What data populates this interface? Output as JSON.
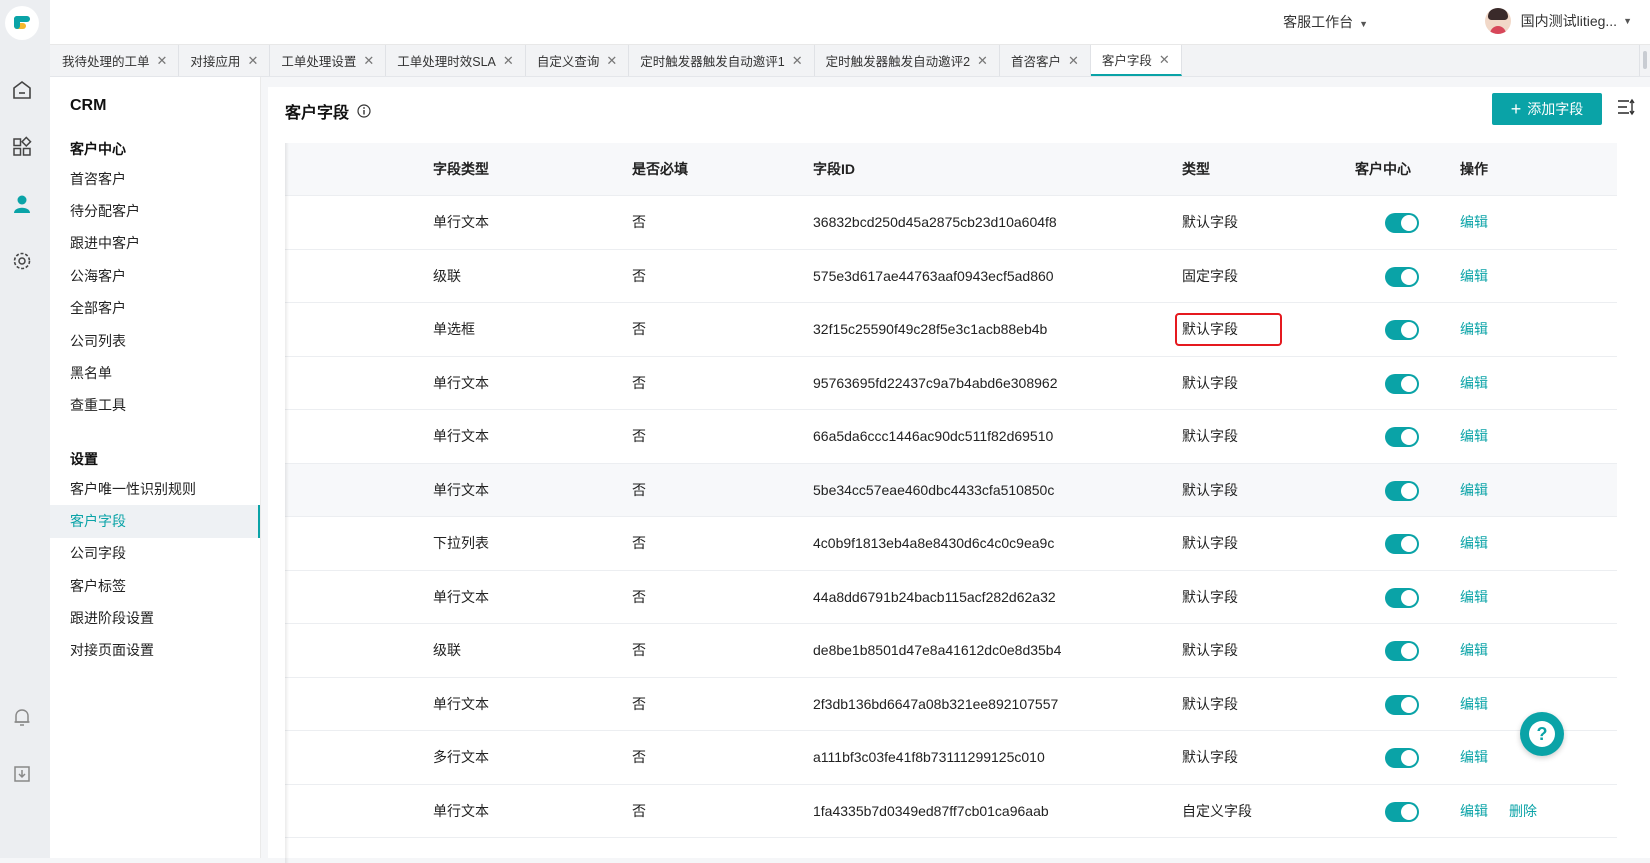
{
  "header": {
    "workspace": "客服工作台",
    "user_name": "国内测试litieg..."
  },
  "tabs": [
    {
      "label": "我待处理的工单",
      "active": false
    },
    {
      "label": "对接应用",
      "active": false
    },
    {
      "label": "工单处理设置",
      "active": false
    },
    {
      "label": "工单处理时效SLA",
      "active": false
    },
    {
      "label": "自定义查询",
      "active": false
    },
    {
      "label": "定时触发器触发自动邀评1",
      "active": false
    },
    {
      "label": "定时触发器触发自动邀评2",
      "active": false
    },
    {
      "label": "首咨客户",
      "active": false
    },
    {
      "label": "客户字段",
      "active": true
    }
  ],
  "sidebar": {
    "title": "CRM",
    "section1": "客户中心",
    "customer_items": [
      "首咨客户",
      "待分配客户",
      "跟进中客户",
      "公海客户",
      "全部客户",
      "公司列表",
      "黑名单",
      "查重工具"
    ],
    "section2": "设置",
    "settings_items": [
      "客户唯一性识别规则",
      "客户字段",
      "公司字段",
      "客户标签",
      "跟进阶段设置",
      "对接页面设置"
    ],
    "active_item": "客户字段"
  },
  "main": {
    "title": "客户字段",
    "add_button": "添加字段"
  },
  "table": {
    "columns": [
      "字段类型",
      "是否必填",
      "字段ID",
      "类型",
      "客户中心",
      "操作"
    ],
    "edit_label": "编辑",
    "delete_label": "删除",
    "rows": [
      {
        "type": "单行文本",
        "required": "否",
        "id": "36832bcd250d45a2875cb23d10a604f8",
        "category": "默认字段",
        "enabled": true
      },
      {
        "type": "级联",
        "required": "否",
        "id": "575e3d617ae44763aaf0943ecf5ad860",
        "category": "固定字段",
        "enabled": true
      },
      {
        "type": "单选框",
        "required": "否",
        "id": "32f15c25590f49c28f5e3c1acb88eb4b",
        "category": "默认字段",
        "enabled": true,
        "highlighted_category": true
      },
      {
        "type": "单行文本",
        "required": "否",
        "id": "95763695fd22437c9a7b4abd6e308962",
        "category": "默认字段",
        "enabled": true
      },
      {
        "type": "单行文本",
        "required": "否",
        "id": "66a5da6ccc1446ac90dc511f82d69510",
        "category": "默认字段",
        "enabled": true
      },
      {
        "type": "单行文本",
        "required": "否",
        "id": "5be34cc57eae460dbc4433cfa510850c",
        "category": "默认字段",
        "enabled": true,
        "hover": true
      },
      {
        "type": "下拉列表",
        "required": "否",
        "id": "4c0b9f1813eb4a8e8430d6c4c0c9ea9c",
        "category": "默认字段",
        "enabled": true
      },
      {
        "type": "单行文本",
        "required": "否",
        "id": "44a8dd6791b24bacb115acf282d62a32",
        "category": "默认字段",
        "enabled": true
      },
      {
        "type": "级联",
        "required": "否",
        "id": "de8be1b8501d47e8a41612dc0e8d35b4",
        "category": "默认字段",
        "enabled": true
      },
      {
        "type": "单行文本",
        "required": "否",
        "id": "2f3db136bd6647a08b321ee892107557",
        "category": "默认字段",
        "enabled": true
      },
      {
        "type": "多行文本",
        "required": "否",
        "id": "a111bf3c03fe41f8b73111299125c010",
        "category": "默认字段",
        "enabled": true
      },
      {
        "type": "单行文本",
        "required": "否",
        "id": "1fa4335b7d0349ed87ff7cb01ca96aab",
        "category": "自定义字段",
        "enabled": true,
        "deletable": true
      }
    ]
  },
  "colors": {
    "accent": "#0aa3a7",
    "highlight_box": "#e5191f"
  },
  "icons": [
    "home-icon",
    "apps-icon",
    "customer-icon",
    "settings-icon",
    "bell-icon",
    "download-icon",
    "info-icon",
    "plus-icon",
    "column-settings-icon",
    "help-icon"
  ]
}
